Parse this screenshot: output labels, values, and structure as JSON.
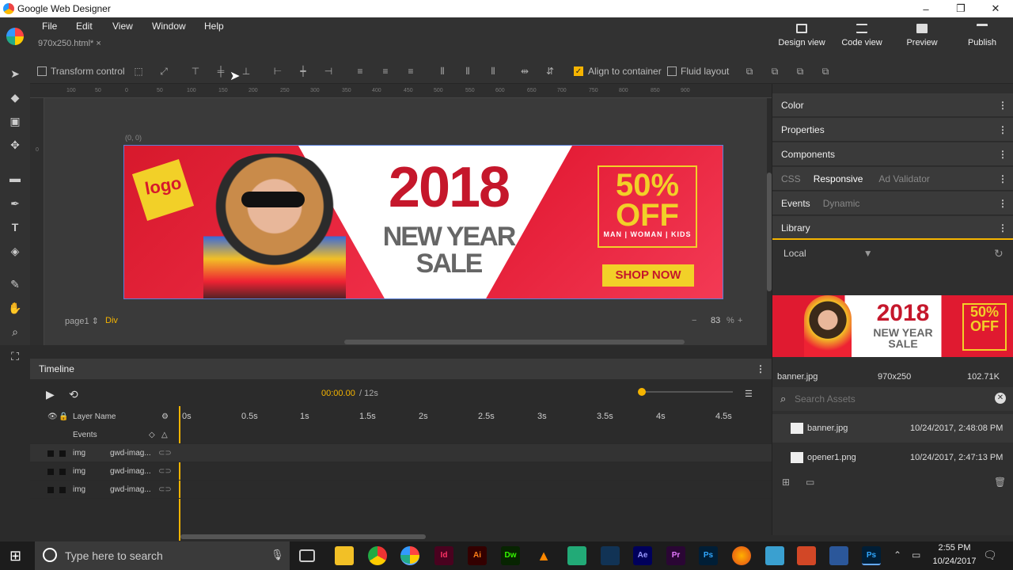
{
  "window": {
    "title": "Google Web Designer",
    "min": "–",
    "max": "❐",
    "close": "✕"
  },
  "menu": [
    "File",
    "Edit",
    "View",
    "Window",
    "Help"
  ],
  "file_tab": "970x250.html*",
  "file_tab_close": "×",
  "header_buttons": [
    "Design view",
    "Code view",
    "Preview",
    "Publish"
  ],
  "toolbar": {
    "transform_label": "Transform control",
    "align_label": "Align to container",
    "fluid_label": "Fluid layout"
  },
  "ruler_x": [
    "100",
    "50",
    "0",
    "50",
    "100",
    "150",
    "200",
    "250",
    "300",
    "350",
    "400",
    "450",
    "500",
    "550",
    "600",
    "650",
    "700",
    "750",
    "800",
    "850",
    "900"
  ],
  "ruler_y": [
    "0"
  ],
  "stage": {
    "origin": "(0, 0)",
    "page": "page1",
    "element": "Div",
    "zoom_minus": "−",
    "zoom": "83",
    "zoom_unit": "%",
    "zoom_plus": "+"
  },
  "banner": {
    "logo": "logo",
    "year": "2018",
    "line1": "NEW YEAR",
    "line2": "SALE",
    "pct": "50%",
    "off": "OFF",
    "sub": "MAN | WOMAN | KIDS",
    "cta": "SHOP NOW"
  },
  "panels": {
    "color": "Color",
    "properties": "Properties",
    "components": "Components",
    "css": "CSS",
    "responsive": "Responsive",
    "ad_validator": "Ad Validator",
    "events": "Events",
    "dynamic": "Dynamic",
    "library": "Library",
    "local": "Local"
  },
  "asset_info": {
    "name": "banner.jpg",
    "dims": "970x250",
    "size": "102.71K"
  },
  "search_placeholder": "Search Assets",
  "assets": [
    {
      "name": "banner.jpg",
      "date": "10/24/2017, 2:48:08 PM"
    },
    {
      "name": "opener1.png",
      "date": "10/24/2017, 2:47:13 PM"
    }
  ],
  "timeline": {
    "title": "Timeline",
    "time": "00:00.00",
    "total": "/ 12s",
    "layer_header": "Layer Name",
    "events": "Events",
    "ticks": [
      "0s",
      "0.5s",
      "1s",
      "1.5s",
      "2s",
      "2.5s",
      "3s",
      "3.5s",
      "4s",
      "4.5s"
    ],
    "layers": [
      {
        "type": "img",
        "name": "gwd-imag..."
      },
      {
        "type": "img",
        "name": "gwd-imag..."
      },
      {
        "type": "img",
        "name": "gwd-imag..."
      }
    ]
  },
  "taskbar": {
    "search": "Type here to search",
    "time": "2:55 PM",
    "date": "10/24/2017",
    "apps": [
      {
        "label": "Id",
        "color": "#ff3366"
      },
      {
        "label": "Ai",
        "color": "#ff7f18"
      },
      {
        "label": "Dw",
        "color": "#35fa00"
      },
      {
        "label": "Ae",
        "color": "#9999ff"
      },
      {
        "label": "Pr",
        "color": "#e579ff"
      },
      {
        "label": "Ps",
        "color": "#31a8ff"
      },
      {
        "label": "Ps",
        "color": "#31a8ff"
      }
    ]
  }
}
